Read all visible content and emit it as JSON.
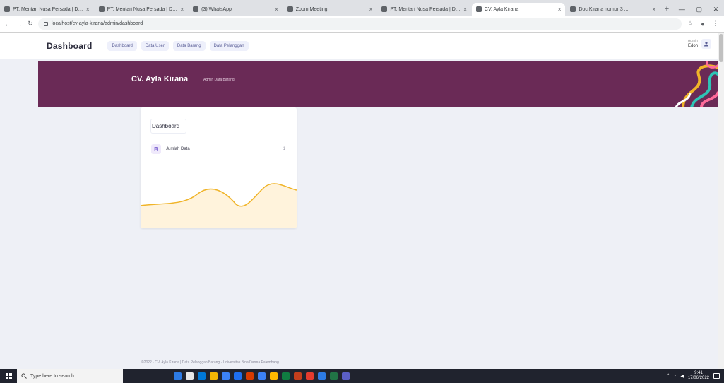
{
  "browser": {
    "tabs": [
      {
        "title": "PT. Mentari Nusa Persada | D3...",
        "active": false
      },
      {
        "title": "PT. Mentari Nusa Persada | D3...",
        "active": false
      },
      {
        "title": "(3) WhatsApp",
        "active": false
      },
      {
        "title": "Zoom Meeting",
        "active": false
      },
      {
        "title": "PT. Mentari Nusa Persada | D3...",
        "active": false
      },
      {
        "title": "CV. Ayla Kirana",
        "active": true
      },
      {
        "title": "Doc Kirana nomor 3 ...",
        "active": false
      }
    ],
    "new_tab_icon": "+",
    "window_controls": [
      "—",
      "▢",
      "✕"
    ],
    "url": "localhost/cv-ayla-kirana/admin/dashboard"
  },
  "app": {
    "brand": "Dashboard",
    "nav": [
      "Dashboard",
      "Data User",
      "Data Barang",
      "Data Pelanggan"
    ],
    "user": {
      "role": "Admin",
      "name": "Edon",
      "avatar_icon": "user-icon"
    },
    "banner": {
      "company": "CV. Ayla Kirana",
      "subtitle": "Admin Data Barang",
      "color": "#6a2a56"
    },
    "card": {
      "title": "Dashboard",
      "stat": {
        "icon_letter": "B",
        "label": "Jumlah Data",
        "value": "1"
      },
      "chart_color": "#f0b429",
      "chart_fill": "#fff3dc"
    },
    "footer": "©2022 · CV. Ayla Kirana | Data Pelanggan Barang · Universitas Bina Darma Palembang"
  },
  "taskbar": {
    "search_placeholder": "Type here to search",
    "clock_time": "9:41",
    "clock_date": "17/06/2022",
    "app_colors": [
      "#2d7be5",
      "#e8e8e8",
      "#0078d7",
      "#f2b705",
      "#3c82f6",
      "#1e6ff0",
      "#d83b01",
      "#3c82f6",
      "#ffb900",
      "#107c41",
      "#c43e1c",
      "#e33b2e",
      "#2d7be5",
      "#217346",
      "#5b5fc7"
    ]
  }
}
